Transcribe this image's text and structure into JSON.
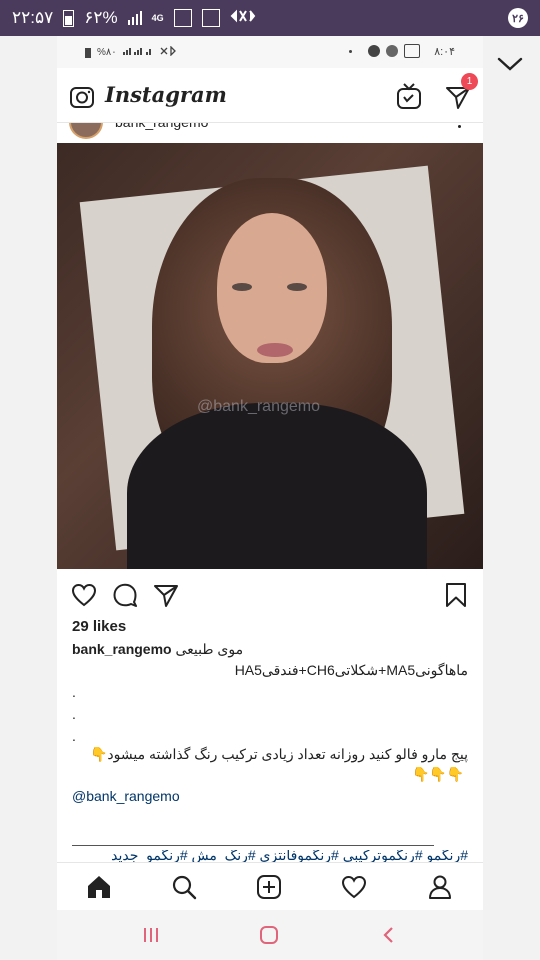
{
  "statusbar": {
    "time": "۲۲:۵۷",
    "battery": "۶۲%",
    "network": "4G",
    "notification_count": "۲۶"
  },
  "inner_status": {
    "time": "۸:۰۴",
    "battery": "%۸۰"
  },
  "app": {
    "logo": "Instagram",
    "direct_badge": "1"
  },
  "post": {
    "username": "bank_rangemo",
    "watermark": "@bank_rangemo",
    "likes": "29 likes",
    "caption_username": "bank_rangemo",
    "caption_line1_text": "موی طبیعی",
    "caption_line2": "ماهاگونیMA5+شکلاتیCH6+فندقیHA5",
    "dot": ".",
    "promo": "پیج مارو فالو کنید روزانه تعداد زیادی ترکیب رنگ گذاشته میشود👇",
    "promo_emojis": "👇👇👇",
    "mention": "@bank_rangemo",
    "hashtags": "#رنگمو #رنگموترکیبی #رنگموفانتزی #رنگ_مش #رنگمو_جدید"
  },
  "icons": {
    "camera": "camera-icon",
    "igtv": "igtv-icon",
    "direct": "direct-icon",
    "like": "heart-icon",
    "comment": "comment-icon",
    "share": "share-icon",
    "save": "bookmark-icon",
    "home": "home-icon",
    "search": "search-icon",
    "add": "add-icon",
    "activity": "heart-icon",
    "profile": "profile-icon"
  },
  "colors": {
    "statusbar": "#4a3b5c",
    "badge": "#ed4956",
    "link": "#003569",
    "sys_nav_icon": "#e0647a"
  }
}
